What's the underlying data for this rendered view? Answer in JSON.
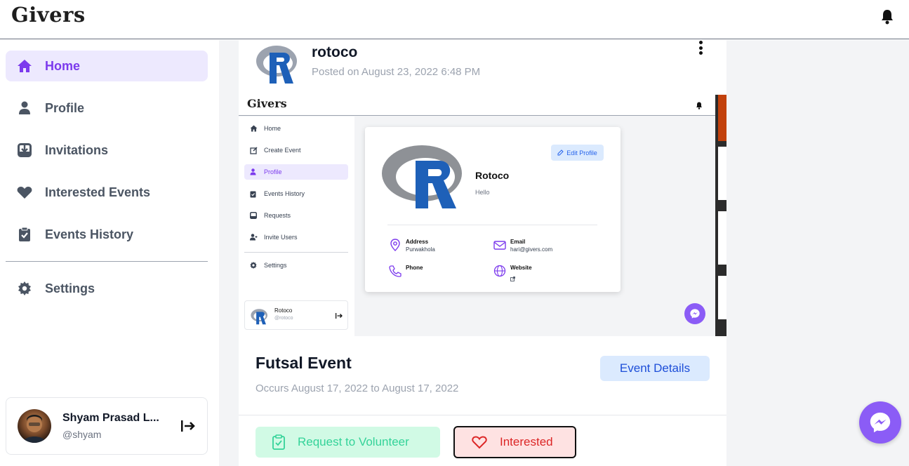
{
  "header": {
    "brand": "Givers"
  },
  "sidebar": {
    "items": [
      {
        "label": "Home",
        "icon": "home-icon",
        "active": true
      },
      {
        "label": "Profile",
        "icon": "user-icon",
        "active": false
      },
      {
        "label": "Invitations",
        "icon": "inbox-icon",
        "active": false
      },
      {
        "label": "Interested Events",
        "icon": "heart-icon",
        "active": false
      },
      {
        "label": "Events History",
        "icon": "clipboard-check-icon",
        "active": false
      }
    ],
    "settings_label": "Settings",
    "user": {
      "name": "Shyam Prasad L...",
      "handle": "@shyam"
    }
  },
  "post": {
    "author": "rotoco",
    "date": "Posted on August 23, 2022 6:48 PM",
    "image": {
      "brand": "Givers",
      "nav": [
        {
          "label": "Home",
          "active": false
        },
        {
          "label": "Create Event",
          "active": false
        },
        {
          "label": "Profile",
          "active": true
        },
        {
          "label": "Events History",
          "active": false
        },
        {
          "label": "Requests",
          "active": false
        },
        {
          "label": "Invite Users",
          "active": false
        }
      ],
      "settings_label": "Settings",
      "user": {
        "name": "Rotoco",
        "handle": "@rotoco"
      },
      "profile": {
        "name": "Rotoco",
        "bio": "Hello",
        "edit_label": "Edit Profile",
        "address_label": "Address",
        "address_value": "Purwakhola",
        "email_label": "Email",
        "email_value": "hari@givers.com",
        "phone_label": "Phone",
        "website_label": "Website"
      }
    },
    "event_title": "Futsal Event",
    "event_dates": "Occurs August 17, 2022 to August 17, 2022",
    "details_label": "Event Details",
    "volunteer_label": "Request to Volunteer",
    "interested_label": "Interested"
  },
  "colors": {
    "accent": "#7c3aed",
    "messenger": "#8b5cf6",
    "success": "#34d399",
    "danger": "#dc2626"
  }
}
